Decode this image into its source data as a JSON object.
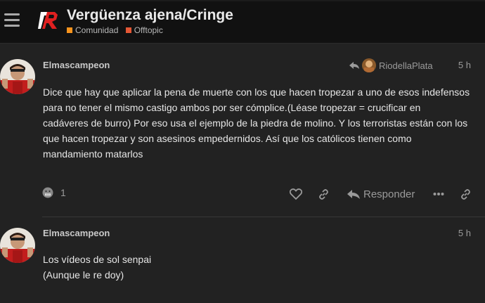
{
  "topic": {
    "title": "Vergüenza ajena/Cringe",
    "categories": [
      {
        "name": "Comunidad",
        "color": "#f7941d"
      },
      {
        "name": "Offtopic",
        "color": "#e45735"
      }
    ]
  },
  "posts": [
    {
      "username": "Elmascampeon",
      "reply_to": "RiodellaPlata",
      "time": "5 h",
      "lines": [
        "Dice que hay que aplicar la pena de muerte con los que hacen tropezar a uno de esos indefensos",
        "para no tener el mismo castigo ambos por ser cómplice.(Léase tropezar = crucificar en",
        "cadáveres de burro) Por eso usa el ejemplo de la piedra de molino. Y los terroristas están con los",
        "que hacen tropezar y son asesinos empedernidos. Así que los católicos tienen como",
        "mandamiento matarlos"
      ],
      "reaction_count": "1",
      "reply_label": "Responder"
    },
    {
      "username": "Elmascampeon",
      "time": "5 h",
      "lines": [
        "Los vídeos de sol senpai",
        "(Aunque le re doy)"
      ]
    }
  ]
}
